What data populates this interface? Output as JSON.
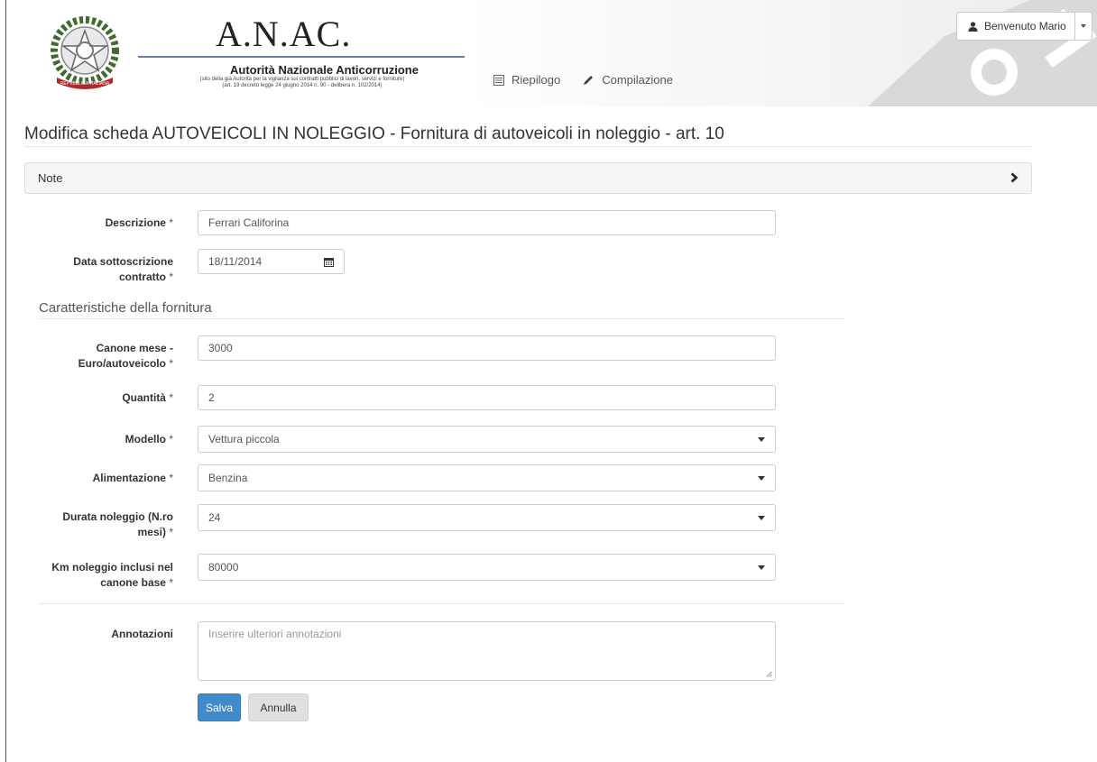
{
  "header": {
    "brand_title": "A.N.AC.",
    "brand_subtitle": "Autorità Nazionale Anticorruzione",
    "brand_note_line1": "(sito della già Autorità per la vigilanza sui contratti pubblici di lavori, servizi e forniture)",
    "brand_note_line2": "(art. 19 decreto legge 24 giugno 2014 n. 90 - delibera n. 102/2014)",
    "emblem_ribbon": "REPVBBLICA ITALIANA",
    "nav": [
      {
        "label": "Riepilogo",
        "icon": "list-icon"
      },
      {
        "label": "Compilazione",
        "icon": "pencil-icon"
      }
    ],
    "user_label": "Benvenuto Mario"
  },
  "page": {
    "title": "Modifica scheda AUTOVEICOLI IN NOLEGGIO - Fornitura di autoveicoli in noleggio - art. 10",
    "note_panel_label": "Note"
  },
  "form": {
    "required_mark": "*",
    "descrizione": {
      "label": "Descrizione",
      "value": "Ferrari Califorina"
    },
    "data_sottoscrizione": {
      "label_line1": "Data sottoscrizione",
      "label_line2": "contratto",
      "value": "18/11/2014"
    },
    "section_title": "Caratteristiche della fornitura",
    "canone": {
      "label_line1": "Canone mese -",
      "label_line2": "Euro/autoveicolo",
      "value": "3000"
    },
    "quantita": {
      "label": "Quantità",
      "value": "2"
    },
    "modello": {
      "label": "Modello",
      "value": "Vettura piccola"
    },
    "alimentazione": {
      "label": "Alimentazione",
      "value": "Benzina"
    },
    "durata": {
      "label_line1": "Durata noleggio (N.ro",
      "label_line2": "mesi)",
      "value": "24"
    },
    "km": {
      "label_line1": "Km noleggio inclusi nel",
      "label_line2": "canone base",
      "value": "80000"
    },
    "annotazioni": {
      "label": "Annotazioni",
      "placeholder": "Inserire ulteriori annotazioni"
    },
    "save_label": "Salva",
    "cancel_label": "Annulla"
  },
  "colors": {
    "primary": "#428bca",
    "watermark": "#d9d9d9"
  }
}
